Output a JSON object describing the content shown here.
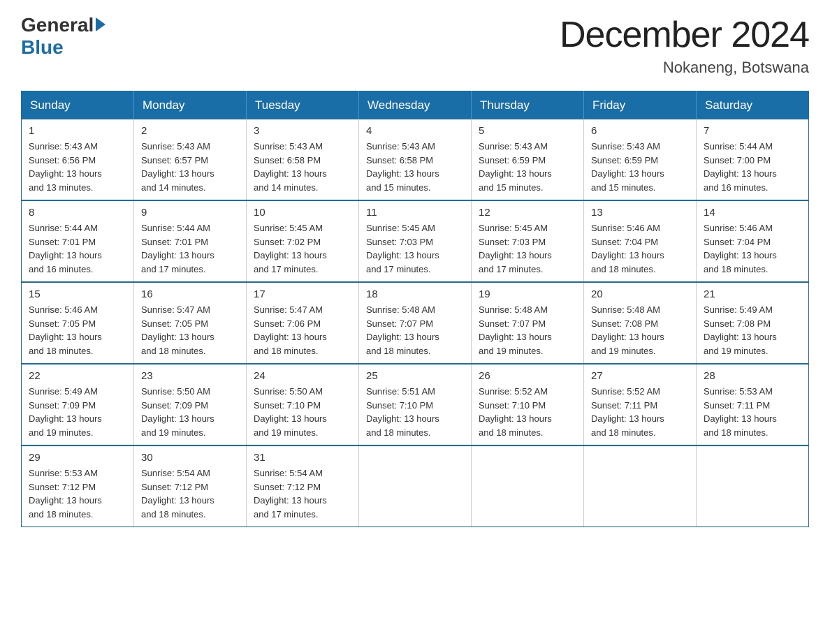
{
  "logo": {
    "general": "General",
    "blue": "Blue"
  },
  "title": {
    "month_year": "December 2024",
    "location": "Nokaneng, Botswana"
  },
  "headers": [
    "Sunday",
    "Monday",
    "Tuesday",
    "Wednesday",
    "Thursday",
    "Friday",
    "Saturday"
  ],
  "weeks": [
    [
      {
        "day": "1",
        "sunrise": "5:43 AM",
        "sunset": "6:56 PM",
        "daylight": "13 hours and 13 minutes."
      },
      {
        "day": "2",
        "sunrise": "5:43 AM",
        "sunset": "6:57 PM",
        "daylight": "13 hours and 14 minutes."
      },
      {
        "day": "3",
        "sunrise": "5:43 AM",
        "sunset": "6:58 PM",
        "daylight": "13 hours and 14 minutes."
      },
      {
        "day": "4",
        "sunrise": "5:43 AM",
        "sunset": "6:58 PM",
        "daylight": "13 hours and 15 minutes."
      },
      {
        "day": "5",
        "sunrise": "5:43 AM",
        "sunset": "6:59 PM",
        "daylight": "13 hours and 15 minutes."
      },
      {
        "day": "6",
        "sunrise": "5:43 AM",
        "sunset": "6:59 PM",
        "daylight": "13 hours and 15 minutes."
      },
      {
        "day": "7",
        "sunrise": "5:44 AM",
        "sunset": "7:00 PM",
        "daylight": "13 hours and 16 minutes."
      }
    ],
    [
      {
        "day": "8",
        "sunrise": "5:44 AM",
        "sunset": "7:01 PM",
        "daylight": "13 hours and 16 minutes."
      },
      {
        "day": "9",
        "sunrise": "5:44 AM",
        "sunset": "7:01 PM",
        "daylight": "13 hours and 17 minutes."
      },
      {
        "day": "10",
        "sunrise": "5:45 AM",
        "sunset": "7:02 PM",
        "daylight": "13 hours and 17 minutes."
      },
      {
        "day": "11",
        "sunrise": "5:45 AM",
        "sunset": "7:03 PM",
        "daylight": "13 hours and 17 minutes."
      },
      {
        "day": "12",
        "sunrise": "5:45 AM",
        "sunset": "7:03 PM",
        "daylight": "13 hours and 17 minutes."
      },
      {
        "day": "13",
        "sunrise": "5:46 AM",
        "sunset": "7:04 PM",
        "daylight": "13 hours and 18 minutes."
      },
      {
        "day": "14",
        "sunrise": "5:46 AM",
        "sunset": "7:04 PM",
        "daylight": "13 hours and 18 minutes."
      }
    ],
    [
      {
        "day": "15",
        "sunrise": "5:46 AM",
        "sunset": "7:05 PM",
        "daylight": "13 hours and 18 minutes."
      },
      {
        "day": "16",
        "sunrise": "5:47 AM",
        "sunset": "7:05 PM",
        "daylight": "13 hours and 18 minutes."
      },
      {
        "day": "17",
        "sunrise": "5:47 AM",
        "sunset": "7:06 PM",
        "daylight": "13 hours and 18 minutes."
      },
      {
        "day": "18",
        "sunrise": "5:48 AM",
        "sunset": "7:07 PM",
        "daylight": "13 hours and 18 minutes."
      },
      {
        "day": "19",
        "sunrise": "5:48 AM",
        "sunset": "7:07 PM",
        "daylight": "13 hours and 19 minutes."
      },
      {
        "day": "20",
        "sunrise": "5:48 AM",
        "sunset": "7:08 PM",
        "daylight": "13 hours and 19 minutes."
      },
      {
        "day": "21",
        "sunrise": "5:49 AM",
        "sunset": "7:08 PM",
        "daylight": "13 hours and 19 minutes."
      }
    ],
    [
      {
        "day": "22",
        "sunrise": "5:49 AM",
        "sunset": "7:09 PM",
        "daylight": "13 hours and 19 minutes."
      },
      {
        "day": "23",
        "sunrise": "5:50 AM",
        "sunset": "7:09 PM",
        "daylight": "13 hours and 19 minutes."
      },
      {
        "day": "24",
        "sunrise": "5:50 AM",
        "sunset": "7:10 PM",
        "daylight": "13 hours and 19 minutes."
      },
      {
        "day": "25",
        "sunrise": "5:51 AM",
        "sunset": "7:10 PM",
        "daylight": "13 hours and 18 minutes."
      },
      {
        "day": "26",
        "sunrise": "5:52 AM",
        "sunset": "7:10 PM",
        "daylight": "13 hours and 18 minutes."
      },
      {
        "day": "27",
        "sunrise": "5:52 AM",
        "sunset": "7:11 PM",
        "daylight": "13 hours and 18 minutes."
      },
      {
        "day": "28",
        "sunrise": "5:53 AM",
        "sunset": "7:11 PM",
        "daylight": "13 hours and 18 minutes."
      }
    ],
    [
      {
        "day": "29",
        "sunrise": "5:53 AM",
        "sunset": "7:12 PM",
        "daylight": "13 hours and 18 minutes."
      },
      {
        "day": "30",
        "sunrise": "5:54 AM",
        "sunset": "7:12 PM",
        "daylight": "13 hours and 18 minutes."
      },
      {
        "day": "31",
        "sunrise": "5:54 AM",
        "sunset": "7:12 PM",
        "daylight": "13 hours and 17 minutes."
      },
      null,
      null,
      null,
      null
    ]
  ],
  "labels": {
    "sunrise": "Sunrise:",
    "sunset": "Sunset:",
    "daylight": "Daylight:"
  }
}
